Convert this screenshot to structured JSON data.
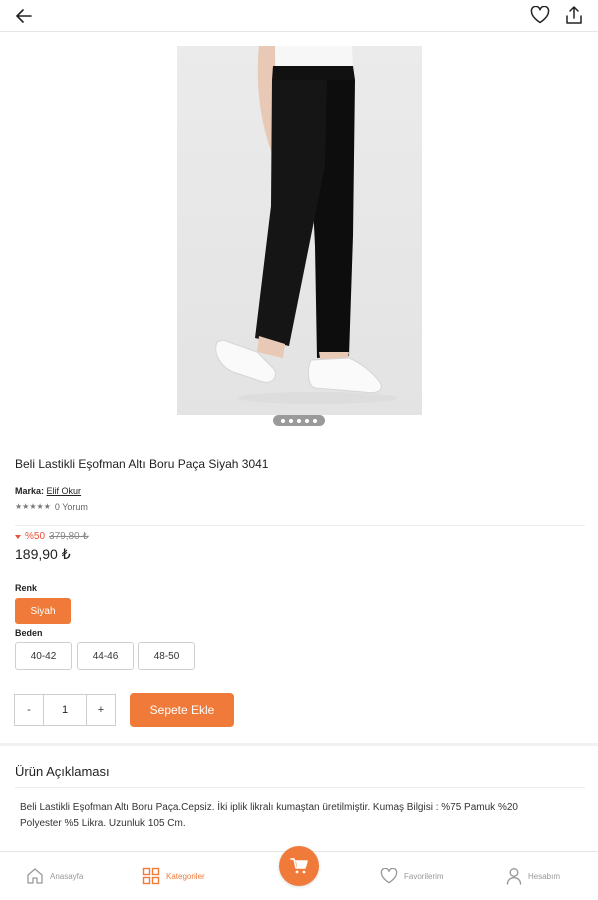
{
  "product": {
    "title": "Beli Lastikli Eşofman Altı Boru Paça Siyah 3041",
    "brand_label": "Marka:",
    "brand_name": "Elif Okur",
    "stars": "★★★★★",
    "review_count": "0 Yorum",
    "discount": "%50",
    "old_price": "379,80 ₺",
    "price": "189,90 ₺",
    "image_count": 5,
    "active_image": 1
  },
  "options": {
    "color_label": "Renk",
    "colors": [
      "Siyah"
    ],
    "size_label": "Beden",
    "sizes": [
      "40-42",
      "44-46",
      "48-50"
    ]
  },
  "cart": {
    "minus": "-",
    "quantity": "1",
    "plus": "+",
    "add_label": "Sepete Ekle"
  },
  "description": {
    "title": "Ürün Açıklaması",
    "text": "Beli Lastikli Eşofman Altı Boru Paça.Cepsiz. İki iplik likralı kumaştan üretilmiştir. Kumaş Bilgisi : %75 Pamuk %20 Polyester %5 Likra. Uzunluk 105 Cm."
  },
  "nav": {
    "home": "Anasayfa",
    "categories": "Kategoriler",
    "favorites": "Favorilerim",
    "account": "Hesabım"
  },
  "colors": {
    "accent": "#f07a3a",
    "discount": "#e8503a"
  }
}
